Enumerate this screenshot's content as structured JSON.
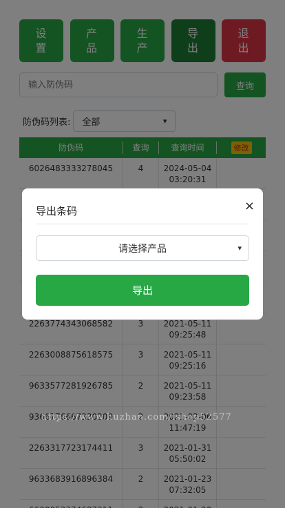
{
  "nav": {
    "settings": "设置",
    "products": "产品",
    "production": "生产",
    "export": "导出",
    "logout": "退出"
  },
  "search": {
    "placeholder": "输入防伪码",
    "button": "查询"
  },
  "filter": {
    "label": "防伪码列表:",
    "selected": "全部"
  },
  "table": {
    "headers": {
      "code": "防伪码",
      "count": "查询",
      "time": "查询时间",
      "edit": "修改"
    },
    "rows": [
      {
        "code": "6026483333278045",
        "count": "4",
        "date": "2024-05-04",
        "time": "03:20:31"
      },
      {
        "code": "",
        "count": "",
        "date": "",
        "time": ""
      },
      {
        "code": "",
        "count": "",
        "date": "",
        "time": ""
      },
      {
        "code": "",
        "count": "",
        "date": "",
        "time": ""
      },
      {
        "code": "",
        "count": "",
        "date": "",
        "time": ""
      },
      {
        "code": "2263774343068582",
        "count": "3",
        "date": "2021-05-11",
        "time": "09:25:48"
      },
      {
        "code": "2263008875618575",
        "count": "3",
        "date": "2021-05-11",
        "time": "09:25:16"
      },
      {
        "code": "9633577281926785",
        "count": "2",
        "date": "2021-05-11",
        "time": "09:23:58"
      },
      {
        "code": "9366776667330209",
        "count": "2",
        "date": "2021-02-06",
        "time": "11:47:19"
      },
      {
        "code": "2263317723174411",
        "count": "3",
        "date": "2021-01-31",
        "time": "05:50:02"
      },
      {
        "code": "9633683916896384",
        "count": "2",
        "date": "2021-01-23",
        "time": "07:32:05"
      },
      {
        "code": "6600053374687311",
        "count": "2",
        "date": "2021-01-20",
        "time": ""
      }
    ]
  },
  "watermark": "https://www.huzhan.com/ishop52577",
  "modal": {
    "title": "导出条码",
    "close": "×",
    "select_placeholder": "请选择产品",
    "export_button": "导出"
  }
}
